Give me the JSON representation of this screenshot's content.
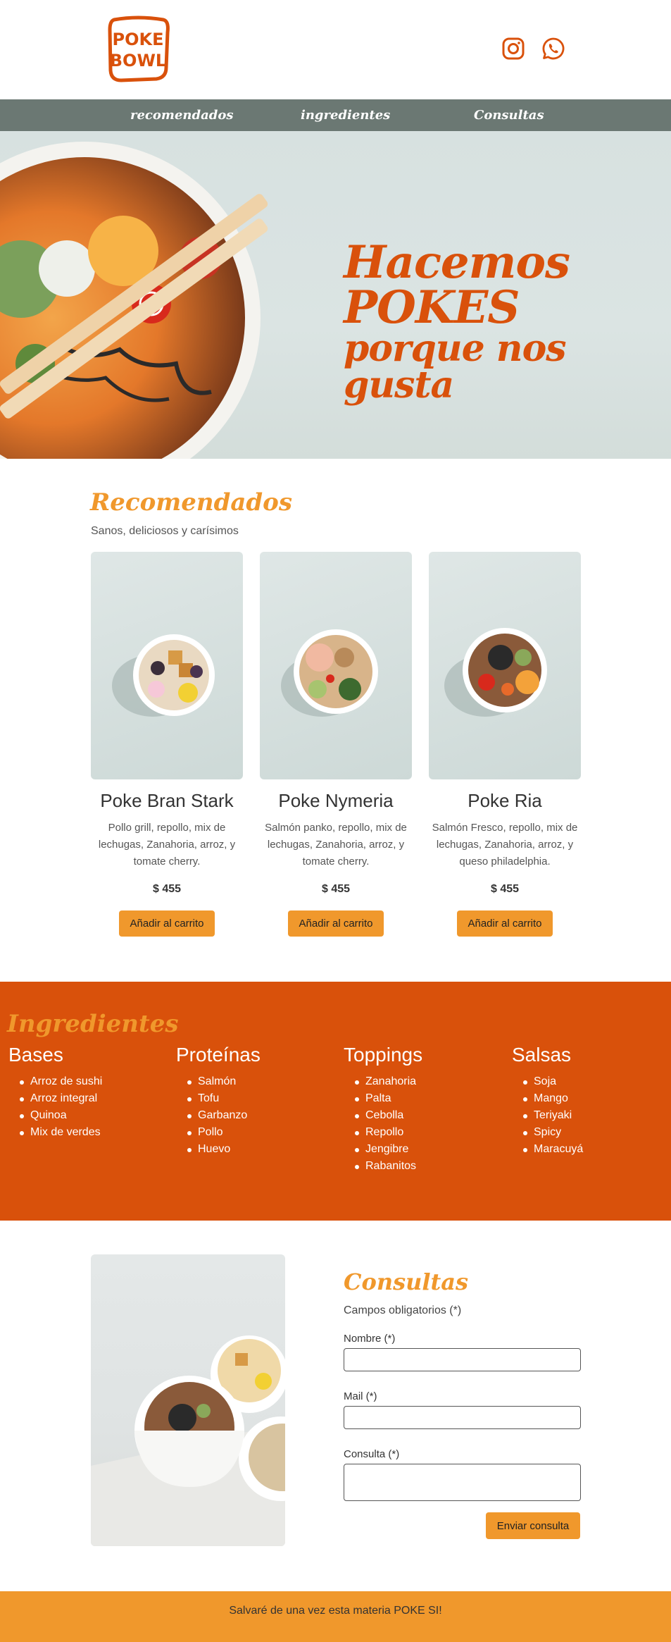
{
  "brand": {
    "logo_line1": "POKE",
    "logo_line2": "BOWL",
    "accent": "#d9510b",
    "secondary": "#f0982c",
    "nav_bg": "#6b7873"
  },
  "social": [
    {
      "icon": "instagram-icon"
    },
    {
      "icon": "whatsapp-icon"
    }
  ],
  "nav": [
    "recomendados",
    "ingredientes",
    "Consultas"
  ],
  "hero": {
    "line1": "Hacemos POKES",
    "line2": "porque nos gusta"
  },
  "recomendados": {
    "title": "Recomendados",
    "subtitle": "Sanos, deliciosos y carísimos",
    "items": [
      {
        "name": "Poke Bran Stark",
        "desc": "Pollo grill, repollo, mix de lechugas, Zanahoria, arroz, y tomate cherry.",
        "price": "$ 455",
        "button": "Añadir al carrito"
      },
      {
        "name": "Poke Nymeria",
        "desc": "Salmón panko, repollo, mix de lechugas, Zanahoria, arroz, y tomate cherry.",
        "price": "$ 455",
        "button": "Añadir al carrito"
      },
      {
        "name": "Poke Ria",
        "desc": "Salmón Fresco, repollo, mix de lechugas, Zanahoria, arroz, y queso philadelphia.",
        "price": "$ 455",
        "button": "Añadir al carrito"
      }
    ]
  },
  "ingredientes": {
    "title": "Ingredientes",
    "columns": [
      {
        "heading": "Bases",
        "items": [
          "Arroz de sushi",
          "Arroz integral",
          "Quinoa",
          "Mix de verdes"
        ]
      },
      {
        "heading": "Proteínas",
        "items": [
          "Salmón",
          "Tofu",
          "Garbanzo",
          "Pollo",
          "Huevo"
        ]
      },
      {
        "heading": "Toppings",
        "items": [
          "Zanahoria",
          "Palta",
          "Cebolla",
          "Repollo",
          "Jengibre",
          "Rabanitos"
        ]
      },
      {
        "heading": "Salsas",
        "items": [
          "Soja",
          "Mango",
          "Teriyaki",
          "Spicy",
          "Maracuyá"
        ]
      }
    ]
  },
  "consultas": {
    "title": "Consultas",
    "required_note": "Campos obligatorios (*)",
    "nombre_label": "Nombre (*)",
    "mail_label": "Mail (*)",
    "consulta_label": "Consulta (*)",
    "nombre_value": "",
    "mail_value": "",
    "consulta_value": "",
    "submit": "Enviar consulta"
  },
  "footer": {
    "text": "Salvaré de una vez esta materia POKE SI!"
  }
}
